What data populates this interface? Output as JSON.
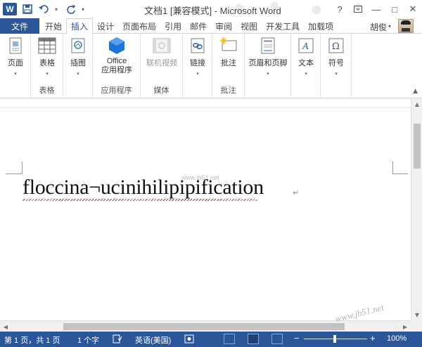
{
  "window": {
    "title": "文档1 [兼容模式] - Microsoft Word",
    "app_logo": "W",
    "help": "?",
    "restore_icon": "ribbon-display-icon",
    "minimize": "—",
    "maximize": "□",
    "close": "✕"
  },
  "quick_access": {
    "save_icon": "save-icon",
    "undo_icon": "undo-icon",
    "redo_icon": "redo-icon",
    "customize_icon": "customize-icon"
  },
  "tabs": {
    "file": "文件",
    "items": [
      "开始",
      "插入",
      "设计",
      "页面布局",
      "引用",
      "邮件",
      "审阅",
      "视图",
      "开发工具",
      "加载项"
    ],
    "active": "插入",
    "user": "胡俊"
  },
  "ribbon": {
    "pages": {
      "label": "页面",
      "icon": "pages-icon"
    },
    "table": {
      "label": "表格",
      "group": "表格",
      "icon": "table-icon"
    },
    "illustrations": {
      "label": "插图",
      "icon": "illustrations-icon"
    },
    "office_apps": {
      "label_line1": "Office",
      "label_line2": "应用程序",
      "group": "应用程序",
      "icon": "office-apps-icon"
    },
    "online_video": {
      "label": "联机视频",
      "group": "媒体",
      "icon": "video-icon"
    },
    "links": {
      "label": "链接",
      "icon": "link-icon"
    },
    "comment": {
      "label": "批注",
      "group": "批注",
      "icon": "comment-icon"
    },
    "header_footer": {
      "label": "页眉和页脚",
      "icon": "header-footer-icon"
    },
    "text": {
      "label": "文本",
      "icon": "text-icon"
    },
    "symbols": {
      "label": "符号",
      "icon": "symbol-icon",
      "glyph": "Ω"
    }
  },
  "document": {
    "text": "floccina¬ucinihilipipification",
    "paragraph_mark": "↵",
    "watermark": "www.jb51.net"
  },
  "status": {
    "page": "第 1 页，共 1 页",
    "words": "1 个字",
    "language": "英语(美国)",
    "zoom": "100%",
    "zoom_minus": "−",
    "zoom_plus": "+"
  },
  "site_watermark": "www.jb51.net"
}
